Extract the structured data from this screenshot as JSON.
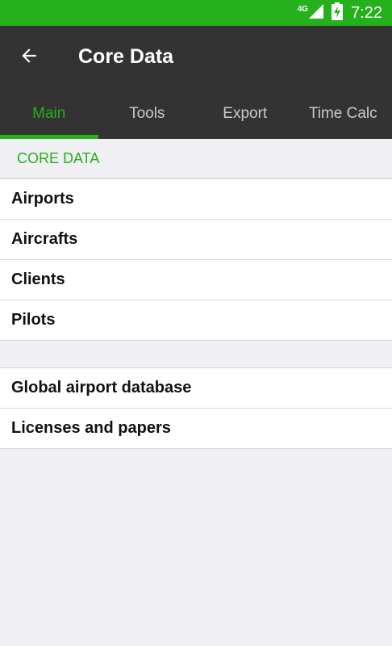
{
  "status_bar": {
    "network": "4G",
    "time": "7:22",
    "icons": [
      "signal-icon",
      "battery-charging-icon"
    ]
  },
  "toolbar": {
    "back_icon": "arrow-left-icon",
    "title": "Core Data"
  },
  "tabs": [
    {
      "label": "Main",
      "active": true
    },
    {
      "label": "Tools",
      "active": false
    },
    {
      "label": "Export",
      "active": false
    },
    {
      "label": "Time Calc",
      "active": false
    }
  ],
  "section": {
    "header": "CORE DATA"
  },
  "core_items": [
    {
      "label": "Airports"
    },
    {
      "label": "Aircrafts"
    },
    {
      "label": "Clients"
    },
    {
      "label": "Pilots"
    }
  ],
  "extra_items": [
    {
      "label": "Global airport database"
    },
    {
      "label": "Licenses and papers"
    }
  ],
  "colors": {
    "accent": "#25b11b",
    "app_bar": "#333333",
    "background": "#efeff4"
  }
}
